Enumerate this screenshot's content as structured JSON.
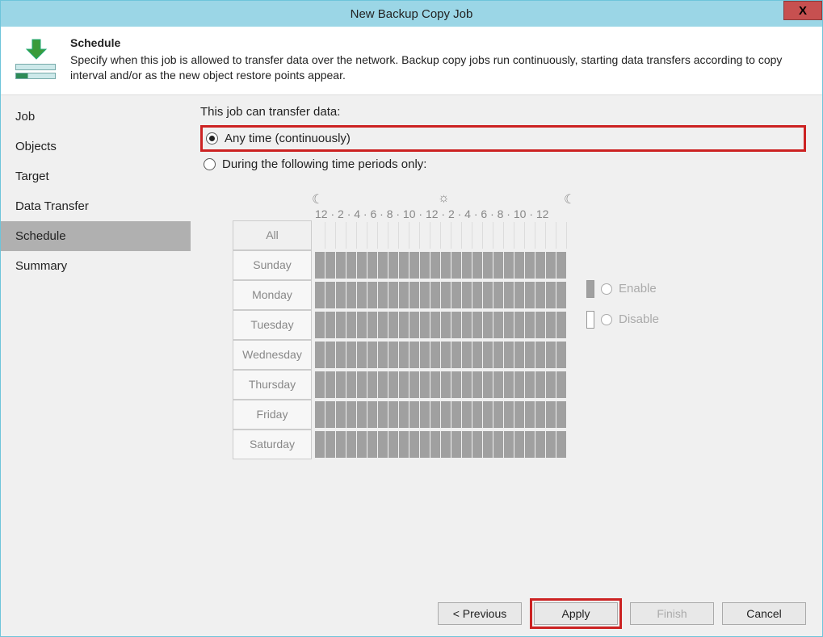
{
  "window": {
    "title": "New Backup Copy Job",
    "close": "X"
  },
  "header": {
    "title": "Schedule",
    "description": "Specify when this job is allowed to transfer data over the network. Backup copy jobs run continuously, starting data transfers according to copy interval and/or as the new object restore points appear."
  },
  "sidebar": {
    "items": [
      {
        "label": "Job",
        "selected": false
      },
      {
        "label": "Objects",
        "selected": false
      },
      {
        "label": "Target",
        "selected": false
      },
      {
        "label": "Data Transfer",
        "selected": false
      },
      {
        "label": "Schedule",
        "selected": true
      },
      {
        "label": "Summary",
        "selected": false
      }
    ]
  },
  "content": {
    "prompt": "This job can transfer data:",
    "option_anytime": "Any time (continuously)",
    "option_periods": "During the following time periods only:",
    "selected_option": "anytime",
    "hours_label": "12 · 2 · 4 · 6 · 8 · 10 · 12 · 2 · 4 · 6 · 8 · 10 · 12",
    "days": [
      "All",
      "Sunday",
      "Monday",
      "Tuesday",
      "Wednesday",
      "Thursday",
      "Friday",
      "Saturday"
    ],
    "legend": {
      "enable": "Enable",
      "disable": "Disable"
    }
  },
  "footer": {
    "previous": "< Previous",
    "apply": "Apply",
    "finish": "Finish",
    "cancel": "Cancel"
  }
}
